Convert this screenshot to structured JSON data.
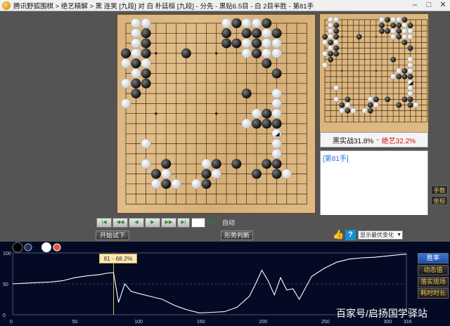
{
  "window": {
    "title": "腾讯野狐围棋 > 绝艺精解 > 黑 连笑 [九段] 对 白 朴廷桓 [九段] - 分先 - 黑贴6.5目 - 白 2目半胜 - 第81手",
    "minimize": "–",
    "maximize": "□",
    "close": "✕"
  },
  "board": {
    "size": 19,
    "black": [
      [
        0,
        11
      ],
      [
        0,
        14
      ],
      [
        1,
        2
      ],
      [
        1,
        10
      ],
      [
        1,
        12
      ],
      [
        1,
        13
      ],
      [
        1,
        15
      ],
      [
        2,
        2
      ],
      [
        2,
        10
      ],
      [
        2,
        11
      ],
      [
        2,
        13
      ],
      [
        3,
        0
      ],
      [
        3,
        2
      ],
      [
        3,
        6
      ],
      [
        3,
        13
      ],
      [
        4,
        1
      ],
      [
        4,
        14
      ],
      [
        5,
        2
      ],
      [
        5,
        15
      ],
      [
        6,
        1
      ],
      [
        6,
        2
      ],
      [
        7,
        1
      ],
      [
        7,
        12
      ],
      [
        8,
        15
      ],
      [
        9,
        14
      ],
      [
        10,
        13
      ],
      [
        10,
        14
      ],
      [
        10,
        15
      ],
      [
        14,
        4
      ],
      [
        14,
        9
      ],
      [
        14,
        11
      ],
      [
        14,
        14
      ],
      [
        14,
        15
      ],
      [
        15,
        3
      ],
      [
        15,
        8
      ],
      [
        15,
        13
      ],
      [
        15,
        15
      ],
      [
        16,
        4
      ],
      [
        16,
        8
      ]
    ],
    "white": [
      [
        0,
        1
      ],
      [
        0,
        2
      ],
      [
        0,
        10
      ],
      [
        0,
        12
      ],
      [
        0,
        13
      ],
      [
        1,
        1
      ],
      [
        1,
        14
      ],
      [
        2,
        1
      ],
      [
        2,
        12
      ],
      [
        2,
        14
      ],
      [
        2,
        15
      ],
      [
        3,
        1
      ],
      [
        3,
        12
      ],
      [
        3,
        14
      ],
      [
        3,
        15
      ],
      [
        4,
        0
      ],
      [
        4,
        2
      ],
      [
        5,
        1
      ],
      [
        6,
        0
      ],
      [
        7,
        15
      ],
      [
        8,
        0
      ],
      [
        8,
        15
      ],
      [
        9,
        13
      ],
      [
        9,
        15
      ],
      [
        10,
        12
      ],
      [
        11,
        15
      ],
      [
        12,
        2
      ],
      [
        12,
        15
      ],
      [
        13,
        15
      ],
      [
        14,
        2
      ],
      [
        14,
        8
      ],
      [
        15,
        4
      ],
      [
        15,
        9
      ],
      [
        15,
        16
      ],
      [
        16,
        3
      ],
      [
        16,
        5
      ],
      [
        16,
        7
      ]
    ],
    "last_move": [
      11,
      15
    ]
  },
  "mini_board": {
    "size": 19
  },
  "score": {
    "black_label": "黑实战31.8%",
    "separator": "-",
    "white_label": "绝艺32.2%"
  },
  "comment": {
    "move_label": "[第81手]"
  },
  "side_tabs": {
    "tab1": "手数",
    "tab2": "坐标"
  },
  "toolbar": {
    "nav": [
      "|◀",
      "◀◀",
      "◀",
      "▶",
      "▶▶",
      "▶|"
    ],
    "go_label": "GO",
    "auto_label": "自动",
    "start_trial": "开始试下",
    "judge": "形势判断",
    "thumb": "👍",
    "help": "?",
    "select_value": "显示最优变化"
  },
  "graph": {
    "y_ticks": [
      "100",
      "50",
      "0"
    ],
    "x_ticks": [
      "0",
      "50",
      "100",
      "150",
      "200",
      "250",
      "300",
      "316"
    ],
    "tooltip": "81 - 68.2%",
    "buttons": [
      "胜率",
      "动态值",
      "落实现场",
      "耗时时长"
    ],
    "watermark": "百家号/启扬国学驿站"
  },
  "chart_data": {
    "type": "line",
    "x_range": [
      0,
      316
    ],
    "y_range": [
      0,
      100
    ],
    "marker_x": 81,
    "marker_y": 68.2,
    "x": [
      0,
      10,
      20,
      30,
      40,
      50,
      60,
      70,
      75,
      80,
      81,
      85,
      90,
      95,
      100,
      110,
      120,
      130,
      140,
      150,
      160,
      170,
      180,
      190,
      195,
      200,
      205,
      210,
      215,
      220,
      225,
      230,
      240,
      250,
      260,
      270,
      280,
      290,
      300,
      310,
      316
    ],
    "y": [
      50,
      51,
      52,
      53,
      55,
      60,
      63,
      65,
      67,
      68,
      68.2,
      20,
      50,
      38,
      35,
      30,
      25,
      15,
      8,
      3,
      4,
      5,
      12,
      30,
      50,
      72,
      55,
      32,
      60,
      40,
      42,
      25,
      62,
      75,
      85,
      90,
      92,
      93,
      95,
      97,
      98
    ]
  }
}
